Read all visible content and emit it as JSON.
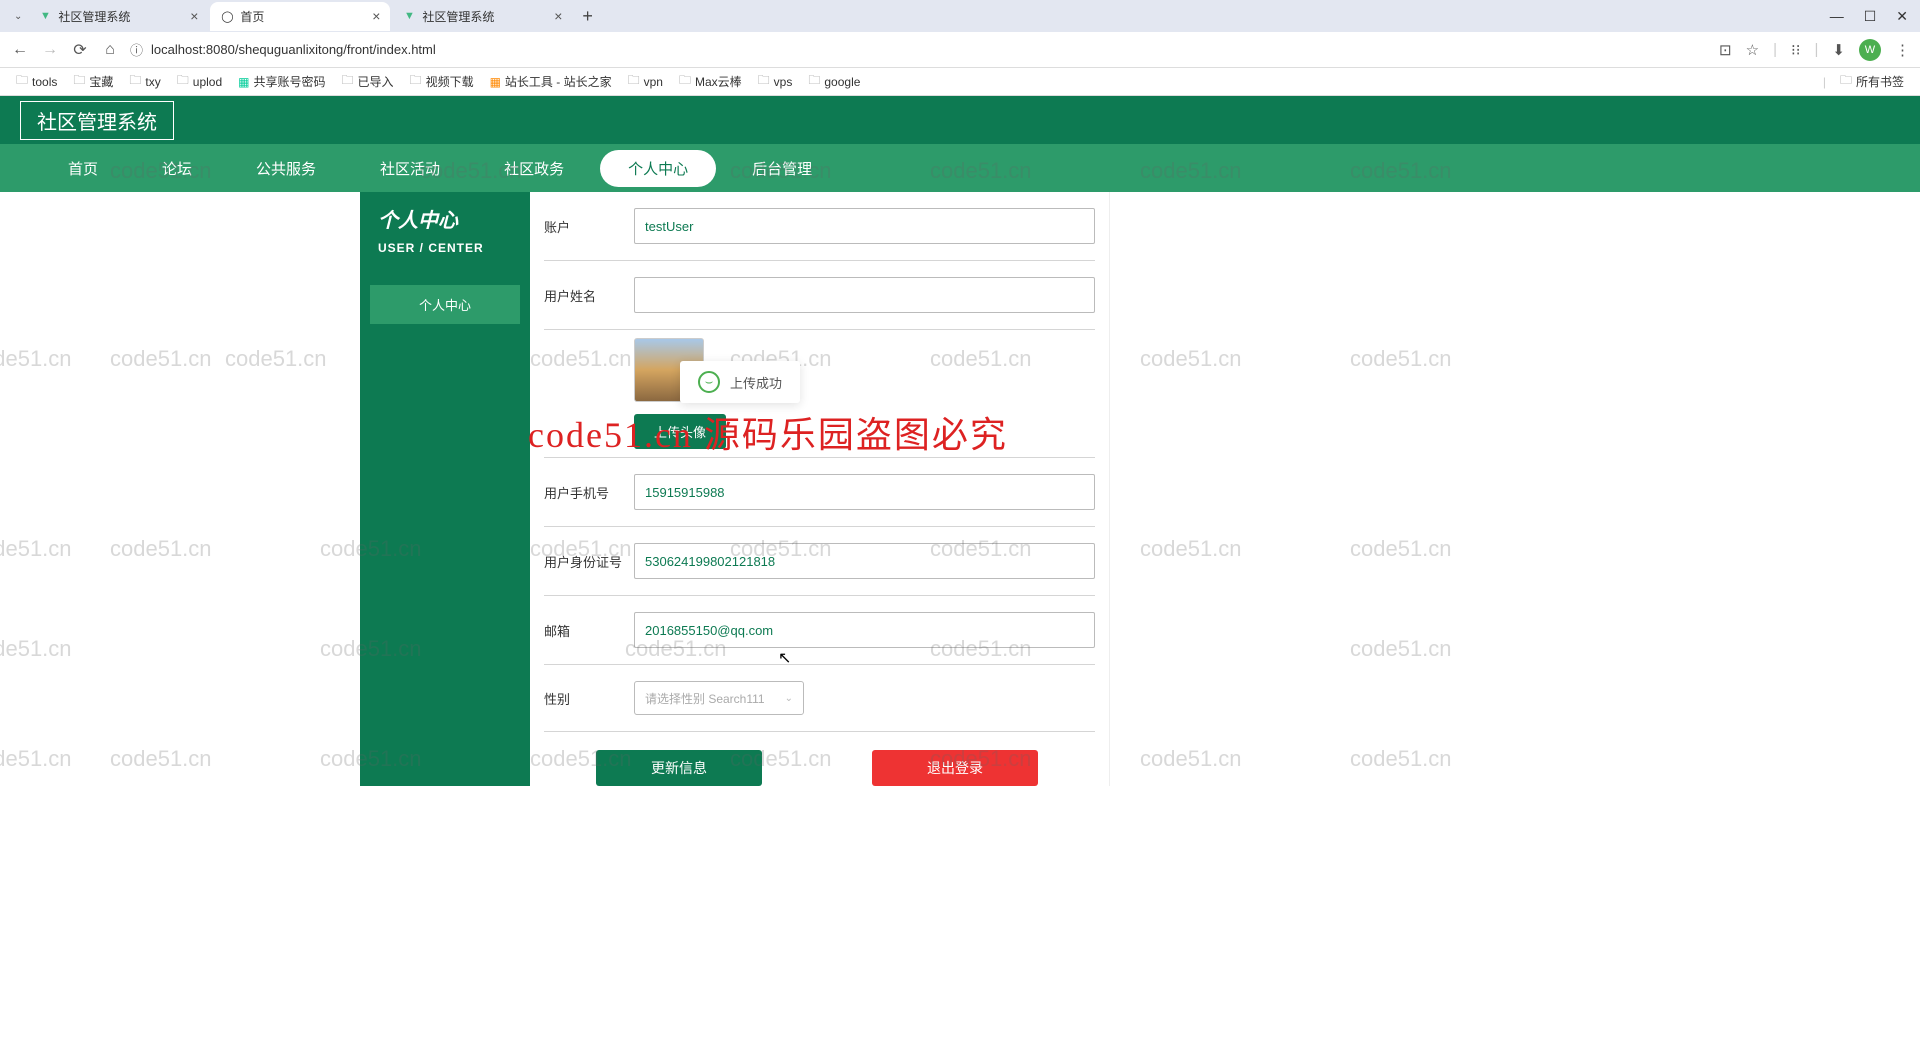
{
  "browser": {
    "tabs": [
      {
        "title": "社区管理系统"
      },
      {
        "title": "首页"
      },
      {
        "title": "社区管理系统"
      }
    ],
    "url": "localhost:8080/shequguanlixitong/front/index.html",
    "avatar_letter": "W",
    "all_bookmarks": "所有书签"
  },
  "bookmarks": [
    "tools",
    "宝藏",
    "txy",
    "uplod",
    "共享账号密码",
    "已导入",
    "视频下载",
    "站长工具 - 站长之家",
    "vpn",
    "Max云棒",
    "vps",
    "google"
  ],
  "app": {
    "title": "社区管理系统",
    "nav": [
      "首页",
      "论坛",
      "公共服务",
      "社区活动",
      "社区政务",
      "个人中心",
      "后台管理"
    ],
    "active_nav_index": 5
  },
  "sidebar": {
    "title": "个人中心",
    "subtitle": "USER / CENTER",
    "item": "个人中心"
  },
  "form": {
    "account_label": "账户",
    "account_value": "testUser",
    "username_label": "用户姓名",
    "phone_label": "用户手机号",
    "phone_value": "15915915988",
    "idcard_label": "用户身份证号",
    "idcard_value": "530624199802121818",
    "email_label": "邮箱",
    "email_value": "2016855150@qq.com",
    "gender_label": "性别",
    "gender_placeholder": "请选择性别 Search111",
    "upload_label": "上传头像",
    "update_btn": "更新信息",
    "logout_btn": "退出登录"
  },
  "toast": {
    "text": "上传成功"
  },
  "watermark": {
    "small": "code51.cn",
    "big": "code51.cn 源码乐园盗图必究"
  }
}
